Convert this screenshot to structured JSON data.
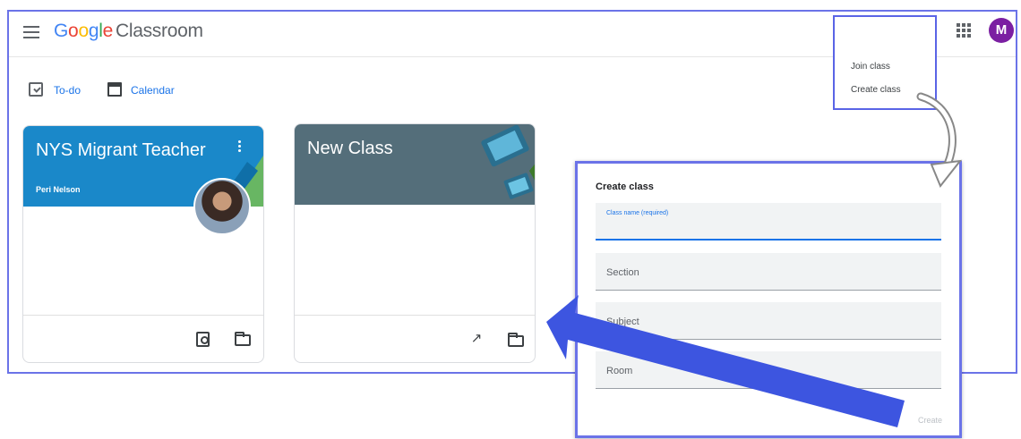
{
  "header": {
    "logo_google": [
      "G",
      "o",
      "o",
      "g",
      "l",
      "e"
    ],
    "logo_product": "Classroom",
    "plus_symbol": "+",
    "avatar_letter": "M"
  },
  "add_menu": {
    "items": [
      {
        "label": "Join class"
      },
      {
        "label": "Create class"
      }
    ]
  },
  "subnav": {
    "todo_label": "To-do",
    "calendar_label": "Calendar"
  },
  "cards": [
    {
      "title": "NYS Migrant Teacher",
      "subtitle": "Peri Nelson",
      "banner_color": "#1a88c9"
    },
    {
      "title": "New Class",
      "subtitle": "",
      "banner_color": "#546e7a"
    }
  ],
  "dialog": {
    "title": "Create class",
    "fields": [
      {
        "placeholder": "Class name (required)"
      },
      {
        "placeholder": "Section"
      },
      {
        "placeholder": "Subject"
      },
      {
        "placeholder": "Room"
      }
    ],
    "create_label": "Create"
  },
  "colors": {
    "highlight_border": "#6b73e8",
    "arrow_blue": "#3d55e0",
    "accent_blue": "#1a73e8"
  }
}
